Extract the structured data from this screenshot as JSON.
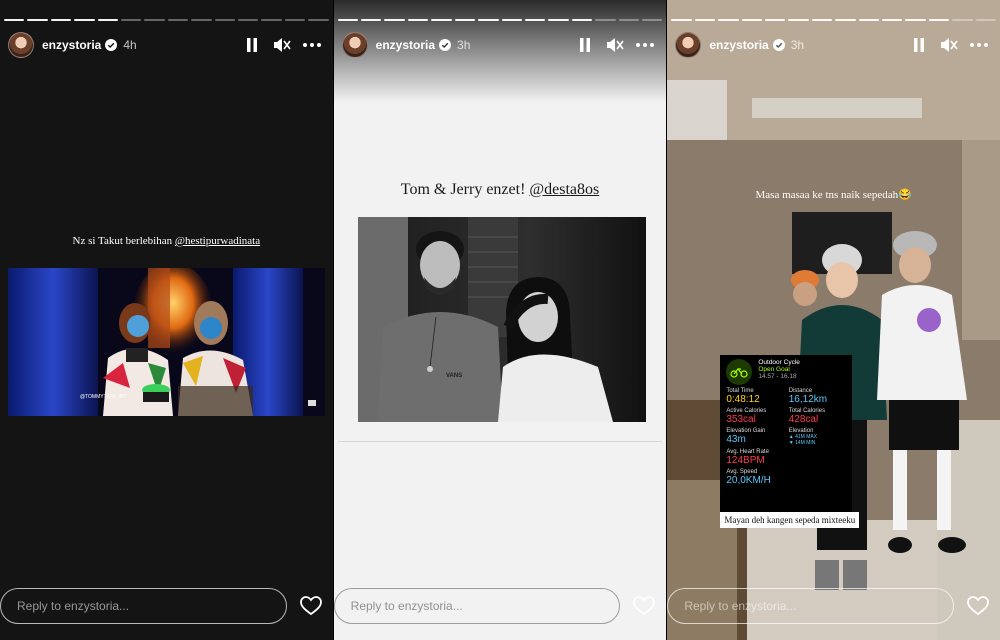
{
  "stories": [
    {
      "username": "enzystoria",
      "time": "4h",
      "caption_text": "Nz si Takut berlebihan ",
      "caption_mention": "@hestipurwadinata",
      "photo_watermark": "@TOMMYTJAK_WT",
      "reply_placeholder": "Reply to enzystoria..."
    },
    {
      "username": "enzystoria",
      "time": "3h",
      "caption_text": "Tom & Jerry enzet! ",
      "caption_mention": "@desta8os",
      "shirt_text": "VANS",
      "reply_placeholder": "Reply to enzystoria..."
    },
    {
      "username": "enzystoria",
      "time": "3h",
      "caption_text": "Masa masaa ke tns naik sepedah😂",
      "workout": {
        "title": "Outdoor Cycle",
        "subtitle": "Open Goal",
        "time_range": "14.57 - 16.18",
        "total_time_label": "Total Time",
        "total_time": "0:48:12",
        "distance_label": "Distance",
        "distance": "16,12km",
        "active_cal_label": "Active Calories",
        "active_cal": "353cal",
        "total_cal_label": "Total Calories",
        "total_cal": "428cal",
        "elev_gain_label": "Elevation Gain",
        "elev_gain": "43m",
        "elevation_label": "Elevation",
        "elev_max": "▲ 41M MAX",
        "elev_min": "▼ 14M MIN",
        "hr_label": "Avg. Heart Rate",
        "hr": "124BPM",
        "speed_label": "Avg. Speed",
        "speed": "20,0KM/H"
      },
      "tag_text": "Mayan deh kangen sepeda mixteeku",
      "reply_placeholder": "Reply to enzystoria..."
    }
  ],
  "colors": {
    "red": "#ff3b4f",
    "blue": "#5ac8fa",
    "green": "#a6ff00"
  }
}
